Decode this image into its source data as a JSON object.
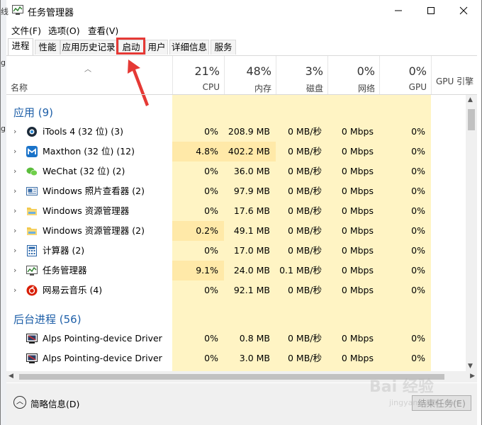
{
  "window": {
    "title": "任务管理器",
    "controls": {
      "minimize": "—",
      "maximize": "☐",
      "close": "✕"
    }
  },
  "left_edge_text": [
    "线",
    "g",
    "g"
  ],
  "menu": [
    {
      "label": "文件(F)"
    },
    {
      "label": "选项(O)"
    },
    {
      "label": "查看(V)"
    }
  ],
  "tabs": [
    {
      "label": "进程",
      "active": true
    },
    {
      "label": "性能"
    },
    {
      "label": "应用历史记录"
    },
    {
      "label": "启动",
      "highlighted": true
    },
    {
      "label": "用户"
    },
    {
      "label": "详细信息"
    },
    {
      "label": "服务"
    }
  ],
  "header": {
    "name_label": "名称",
    "columns": [
      {
        "pct": "21%",
        "label": "CPU"
      },
      {
        "pct": "48%",
        "label": "内存"
      },
      {
        "pct": "3%",
        "label": "磁盘"
      },
      {
        "pct": "0%",
        "label": "网络"
      },
      {
        "pct": "0%",
        "label": "GPU"
      },
      {
        "pct": "",
        "label": "GPU 引擎"
      }
    ]
  },
  "groups": [
    {
      "title": "应用 (9)",
      "rows": [
        {
          "name": "iTools 4 (32 位) (3)",
          "icon": "itools-icon",
          "cpu": "0%",
          "mem": "208.9 MB",
          "disk": "0 MB/秒",
          "net": "0 Mbps",
          "gpu": "0%"
        },
        {
          "name": "Maxthon (32 位) (12)",
          "icon": "maxthon-icon",
          "cpu": "4.8%",
          "mem": "402.2 MB",
          "disk": "0 MB/秒",
          "net": "0 Mbps",
          "gpu": "0%"
        },
        {
          "name": "WeChat (32 位) (2)",
          "icon": "wechat-icon",
          "cpu": "0%",
          "mem": "36.0 MB",
          "disk": "0 MB/秒",
          "net": "0 Mbps",
          "gpu": "0%"
        },
        {
          "name": "Windows 照片查看器 (2)",
          "icon": "photo-viewer-icon",
          "cpu": "0%",
          "mem": "97.9 MB",
          "disk": "0 MB/秒",
          "net": "0 Mbps",
          "gpu": "0%"
        },
        {
          "name": "Windows 资源管理器",
          "icon": "folder-icon",
          "cpu": "0%",
          "mem": "17.6 MB",
          "disk": "0 MB/秒",
          "net": "0 Mbps",
          "gpu": "0%"
        },
        {
          "name": "Windows 资源管理器 (2)",
          "icon": "folder-icon",
          "cpu": "0.2%",
          "mem": "49.1 MB",
          "disk": "0 MB/秒",
          "net": "0 Mbps",
          "gpu": "0%"
        },
        {
          "name": "计算器 (2)",
          "icon": "calculator-icon",
          "cpu": "0%",
          "mem": "17.0 MB",
          "disk": "0 MB/秒",
          "net": "0 Mbps",
          "gpu": "0%"
        },
        {
          "name": "任务管理器",
          "icon": "task-manager-icon",
          "cpu": "9.1%",
          "mem": "24.0 MB",
          "disk": "0.1 MB/秒",
          "net": "0 Mbps",
          "gpu": "0%"
        },
        {
          "name": "网易云音乐 (4)",
          "icon": "netease-music-icon",
          "cpu": "0%",
          "mem": "92.1 MB",
          "disk": "0 MB/秒",
          "net": "0 Mbps",
          "gpu": "0%"
        }
      ]
    },
    {
      "title": "后台进程 (56)",
      "rows": [
        {
          "name": "Alps Pointing-device Driver",
          "icon": "alps-driver-icon",
          "cpu": "0%",
          "mem": "0.8 MB",
          "disk": "0 MB/秒",
          "net": "0 Mbps",
          "gpu": "0%"
        },
        {
          "name": "Alps Pointing-device Driver",
          "icon": "alps-driver-icon",
          "cpu": "0%",
          "mem": "3.0 MB",
          "disk": "0 MB/秒",
          "net": "0 Mbps",
          "gpu": "0%"
        }
      ]
    }
  ],
  "footer": {
    "fewer_details": "简略信息(D)",
    "end_task": "结束任务(E)"
  },
  "watermark": {
    "line1": "Bai 经验",
    "line2": "jingyan.baidu.com"
  },
  "colors": {
    "highlight": "#fff4c4",
    "group_title": "#1e5fa8",
    "annotation_red": "#e53935"
  }
}
